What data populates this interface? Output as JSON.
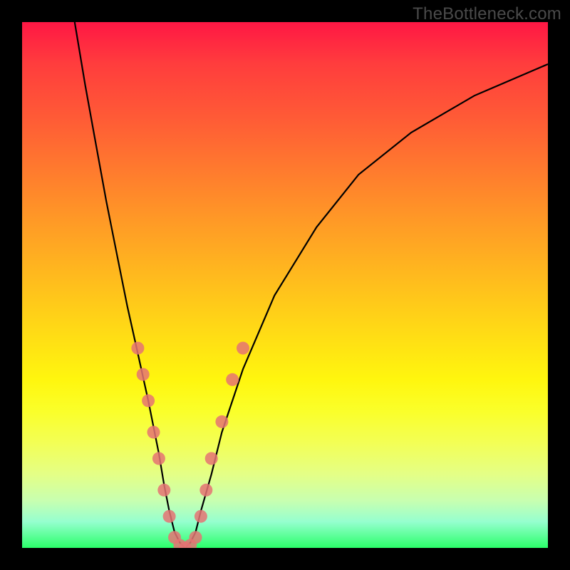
{
  "watermark": "TheBottleneck.com",
  "chart_data": {
    "type": "line",
    "title": "",
    "xlabel": "",
    "ylabel": "",
    "xlim": [
      0,
      100
    ],
    "ylim": [
      0,
      100
    ],
    "series": [
      {
        "name": "bottleneck-curve",
        "x": [
          10,
          12,
          14,
          16,
          18,
          20,
          22,
          24,
          26,
          27,
          28,
          29,
          30,
          31,
          32,
          33,
          34,
          36,
          38,
          42,
          48,
          56,
          64,
          74,
          86,
          100
        ],
        "y": [
          100,
          88,
          77,
          66,
          56,
          46,
          37,
          28,
          18,
          12,
          7,
          3,
          1,
          0,
          1,
          3,
          7,
          14,
          22,
          34,
          48,
          61,
          71,
          79,
          86,
          92
        ]
      }
    ],
    "markers": {
      "name": "highlight-dots",
      "color": "#e57373",
      "points": [
        {
          "x": 22,
          "y": 38
        },
        {
          "x": 23,
          "y": 33
        },
        {
          "x": 24,
          "y": 28
        },
        {
          "x": 25,
          "y": 22
        },
        {
          "x": 26,
          "y": 17
        },
        {
          "x": 27,
          "y": 11
        },
        {
          "x": 28,
          "y": 6
        },
        {
          "x": 29,
          "y": 2
        },
        {
          "x": 30,
          "y": 0.5
        },
        {
          "x": 31,
          "y": 0
        },
        {
          "x": 32,
          "y": 0.5
        },
        {
          "x": 33,
          "y": 2
        },
        {
          "x": 34,
          "y": 6
        },
        {
          "x": 35,
          "y": 11
        },
        {
          "x": 36,
          "y": 17
        },
        {
          "x": 38,
          "y": 24
        },
        {
          "x": 40,
          "y": 32
        },
        {
          "x": 42,
          "y": 38
        }
      ]
    },
    "gradient_stops": [
      {
        "pos": 0,
        "color": "#ff1744"
      },
      {
        "pos": 50,
        "color": "#ffd816"
      },
      {
        "pos": 100,
        "color": "#2bff6a"
      }
    ]
  }
}
